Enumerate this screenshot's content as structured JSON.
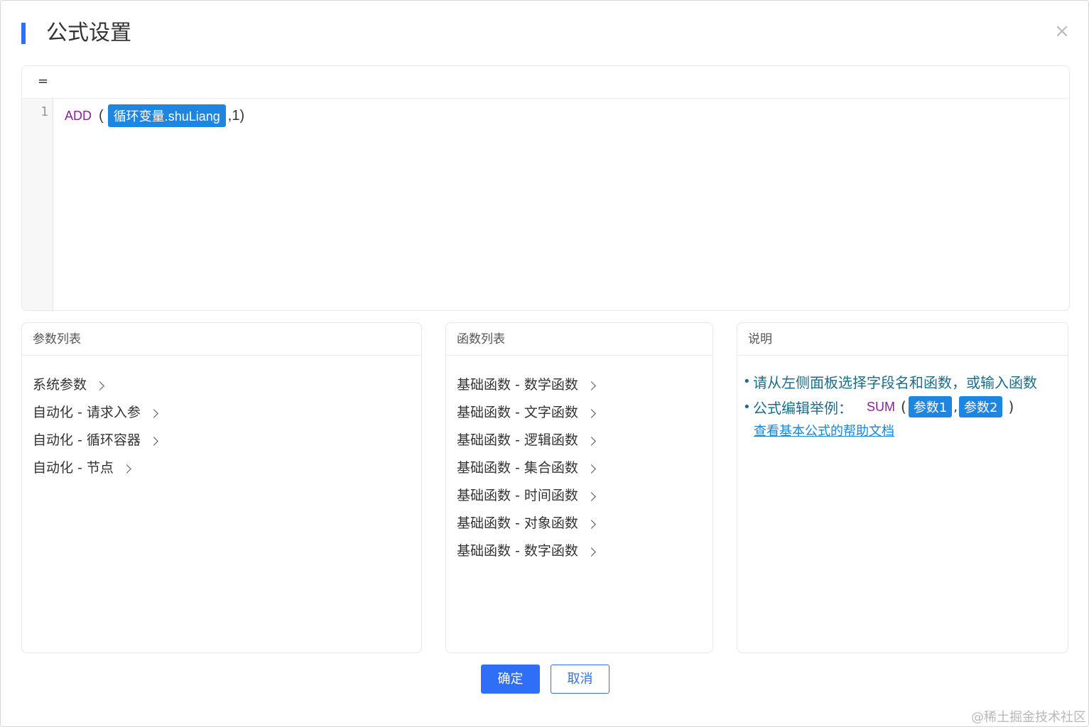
{
  "dialog": {
    "title": "公式设置",
    "close_symbol": "×"
  },
  "editor": {
    "prefix": "=",
    "line_number": "1",
    "formula": {
      "function": "ADD",
      "open_paren": "(",
      "variable": "循环变量.shuLiang",
      "rest": ",1)"
    }
  },
  "params_panel": {
    "title": "参数列表",
    "items": [
      {
        "label": "系统参数"
      },
      {
        "label": "自动化 - 请求入参"
      },
      {
        "label": "自动化 - 循环容器"
      },
      {
        "label": "自动化 - 节点"
      }
    ]
  },
  "functions_panel": {
    "title": "函数列表",
    "items": [
      {
        "label": "基础函数 - 数学函数"
      },
      {
        "label": "基础函数 - 文字函数"
      },
      {
        "label": "基础函数 - 逻辑函数"
      },
      {
        "label": "基础函数 - 集合函数"
      },
      {
        "label": "基础函数 - 时间函数"
      },
      {
        "label": "基础函数 - 对象函数"
      },
      {
        "label": "基础函数 - 数字函数"
      }
    ]
  },
  "description_panel": {
    "title": "说明",
    "line1": "请从左侧面板选择字段名和函数，或输入函数",
    "line2_label": "公式编辑举例：",
    "example": {
      "function": "SUM",
      "open_paren": "(",
      "arg1": "参数1",
      "comma": ",",
      "arg2": "参数2",
      "close_paren": ")"
    },
    "help_link": "查看基本公式的帮助文档"
  },
  "footer": {
    "ok_label": "确定",
    "cancel_label": "取消"
  },
  "watermark": "@稀土掘金技术社区",
  "colors": {
    "accent": "#2f6ef6",
    "chip": "#1e86e0",
    "function_name": "#8b1f9c",
    "description_text": "#1b6d8a"
  }
}
